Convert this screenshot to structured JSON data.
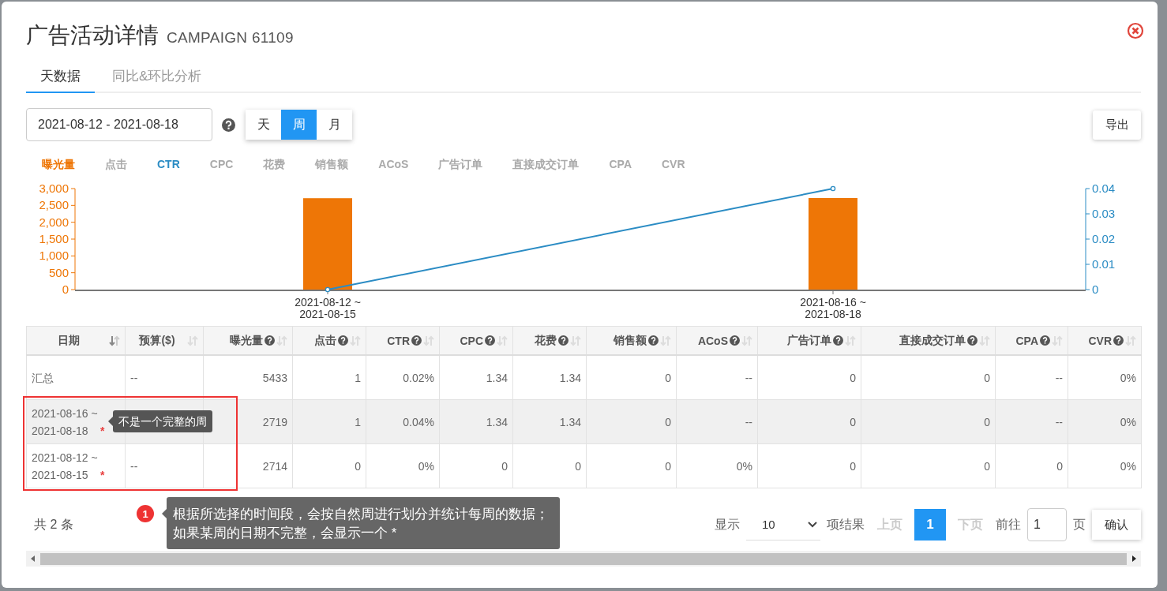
{
  "dialog": {
    "title": "广告活动详情",
    "subtitle": "CAMPAIGN 61109"
  },
  "tabs": [
    {
      "label": "天数据",
      "selected": true
    },
    {
      "label": "同比&环比分析",
      "selected": false
    }
  ],
  "toolbar": {
    "date_range": "2021-08-12 - 2021-08-18",
    "granularity": [
      {
        "label": "天",
        "selected": false
      },
      {
        "label": "周",
        "selected": true
      },
      {
        "label": "月",
        "selected": false
      }
    ],
    "export_button": "导出"
  },
  "metrics": [
    {
      "label": "曝光量",
      "selected": true,
      "color": "#ee7606"
    },
    {
      "label": "点击",
      "selected": false
    },
    {
      "label": "CTR",
      "selected": true,
      "color": "#2b8cc4"
    },
    {
      "label": "CPC",
      "selected": false
    },
    {
      "label": "花费",
      "selected": false
    },
    {
      "label": "销售额",
      "selected": false
    },
    {
      "label": "ACoS",
      "selected": false
    },
    {
      "label": "广告订单",
      "selected": false
    },
    {
      "label": "直接成交订单",
      "selected": false
    },
    {
      "label": "CPA",
      "selected": false
    },
    {
      "label": "CVR",
      "selected": false
    }
  ],
  "chart": {
    "chart_data": {
      "type": "bar",
      "categories": [
        [
          "2021-08-12 ~",
          "2021-08-15"
        ],
        [
          "2021-08-16 ~",
          "2021-08-18"
        ]
      ],
      "series": [
        {
          "color": "#ee7606",
          "values": [
            2714,
            2719
          ]
        },
        {
          "color": "#2b8cc4",
          "values": [
            0,
            0.04
          ]
        }
      ],
      "ylim": [
        0,
        3000
      ],
      "yticks": [
        {
          "value": 0,
          "label": "0"
        },
        {
          "value": 500,
          "label": "500"
        },
        {
          "value": 1000,
          "label": "1,000"
        },
        {
          "value": 1500,
          "label": "1,500"
        },
        {
          "value": 2000,
          "label": "2,000"
        },
        {
          "value": 2500,
          "label": "2,500"
        },
        {
          "value": 3000,
          "label": "3,000"
        }
      ],
      "y2lim": [
        0,
        0.04
      ],
      "y2ticks": [
        {
          "value": 0,
          "label": "0"
        },
        {
          "value": 0.01,
          "label": "0.01"
        },
        {
          "value": 0.02,
          "label": "0.02"
        },
        {
          "value": 0.03,
          "label": "0.03"
        },
        {
          "value": 0.04,
          "label": "0.04"
        }
      ]
    }
  },
  "table": {
    "columns": [
      {
        "label": "日期",
        "help": false,
        "sorted": true
      },
      {
        "label": "预算($)",
        "help": false,
        "sorted": false
      },
      {
        "label": "曝光量",
        "help": true,
        "sorted": false
      },
      {
        "label": "点击",
        "help": true,
        "sorted": false
      },
      {
        "label": "CTR",
        "help": true,
        "sorted": false
      },
      {
        "label": "CPC",
        "help": true,
        "sorted": false
      },
      {
        "label": "花费",
        "help": true,
        "sorted": false
      },
      {
        "label": "销售额",
        "help": true,
        "sorted": false
      },
      {
        "label": "ACoS",
        "help": true,
        "sorted": false
      },
      {
        "label": "广告订单",
        "help": true,
        "sorted": false
      },
      {
        "label": "直接成交订单",
        "help": true,
        "sorted": false
      },
      {
        "label": "CPA",
        "help": true,
        "sorted": false
      },
      {
        "label": "CVR",
        "help": true,
        "sorted": false
      }
    ],
    "rows": [
      {
        "highlighted": false,
        "cells": [
          "汇总",
          "--",
          "5433",
          "1",
          "0.02%",
          "1.34",
          "1.34",
          "0",
          "--",
          "0",
          "0",
          "--",
          "0%"
        ]
      },
      {
        "highlighted": true,
        "asterisk": "*",
        "cells": [
          "2021-08-16 ~ 2021-08-18",
          null,
          "2719",
          "1",
          "0.04%",
          "1.34",
          "1.34",
          "0",
          "--",
          "0",
          "0",
          "--",
          "0%"
        ]
      },
      {
        "highlighted": false,
        "asterisk": "*",
        "cells": [
          "2021-08-12 ~ 2021-08-15",
          "--",
          "2714",
          "0",
          "0%",
          "0",
          "0",
          "0",
          "0%",
          "0",
          "0",
          "0",
          "0%"
        ]
      }
    ]
  },
  "row_tooltip": "不是一个完整的周",
  "note": {
    "number": "1",
    "lines": [
      "根据所选择的时间段，会按自然周进行划分并统计每周的数据；",
      "如果某周的日期不完整，会显示一个 *"
    ]
  },
  "footer": {
    "total": "共 2 条",
    "show_label": "显示",
    "page_size": "10",
    "results_label": "项结果",
    "prev": {
      "label": "上页",
      "disabled": true
    },
    "pages": [
      {
        "label": "1",
        "selected": true
      }
    ],
    "next": {
      "label": "下页",
      "disabled": true
    },
    "goto_label": "前往",
    "goto_value": "1",
    "page_label": "页",
    "confirm": "确认"
  }
}
